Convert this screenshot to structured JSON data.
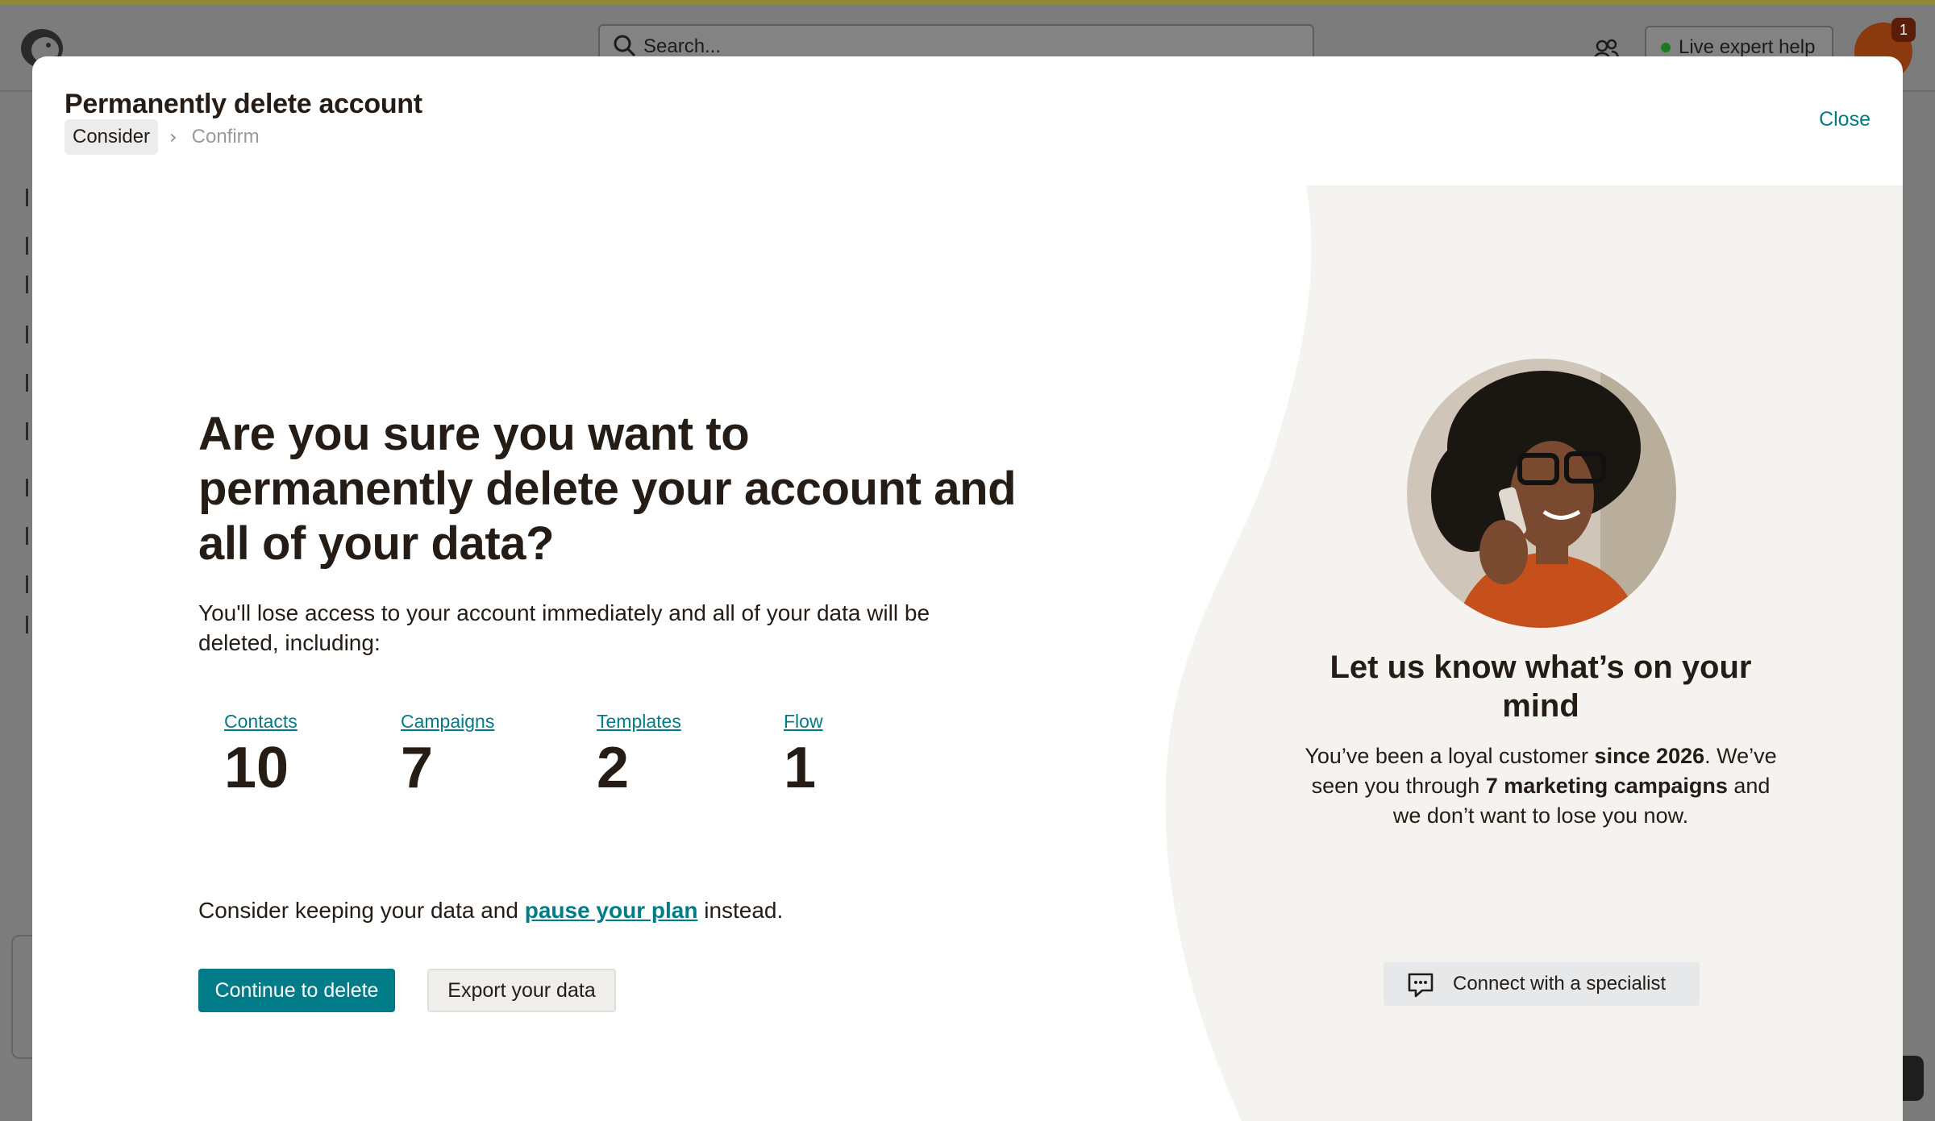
{
  "background_app": {
    "search_placeholder": "Search...",
    "live_help_label": "Live expert help",
    "notification_count": "1"
  },
  "modal": {
    "title": "Permanently delete account",
    "breadcrumb": {
      "active": "Consider",
      "separator": "›",
      "next": "Confirm"
    },
    "close_label": "Close",
    "headline": "Are you sure you want to permanently delete your account and all of your data?",
    "description": "You'll lose access to your account immediately and all of your data will be deleted, including:",
    "stats": [
      {
        "label": "Contacts",
        "value": "10"
      },
      {
        "label": "Campaigns",
        "value": "7"
      },
      {
        "label": "Templates",
        "value": "2"
      },
      {
        "label": "Flow",
        "value": "1"
      }
    ],
    "consider": {
      "prefix": "Consider keeping your data and ",
      "link": "pause your plan",
      "suffix": " instead."
    },
    "primary_button": "Continue to delete",
    "secondary_button": "Export your data",
    "right_panel": {
      "title": "Let us know what’s on your mind",
      "text_parts": {
        "p1": "You’ve been a loyal customer ",
        "b1": "since 2026",
        "p2": ". We’ve seen you through ",
        "b2": "7 marketing campaigns",
        "p3": " and we don’t want to lose you now."
      },
      "connect_button": "Connect with a specialist"
    }
  },
  "colors": {
    "accent": "#007c89",
    "text": "#241c15",
    "panel_bg": "#f4f3ef"
  },
  "icons": [
    "mailchimp-logo-icon",
    "search-icon",
    "people-icon",
    "chat-bubble-icon",
    "chevron-right-icon"
  ]
}
